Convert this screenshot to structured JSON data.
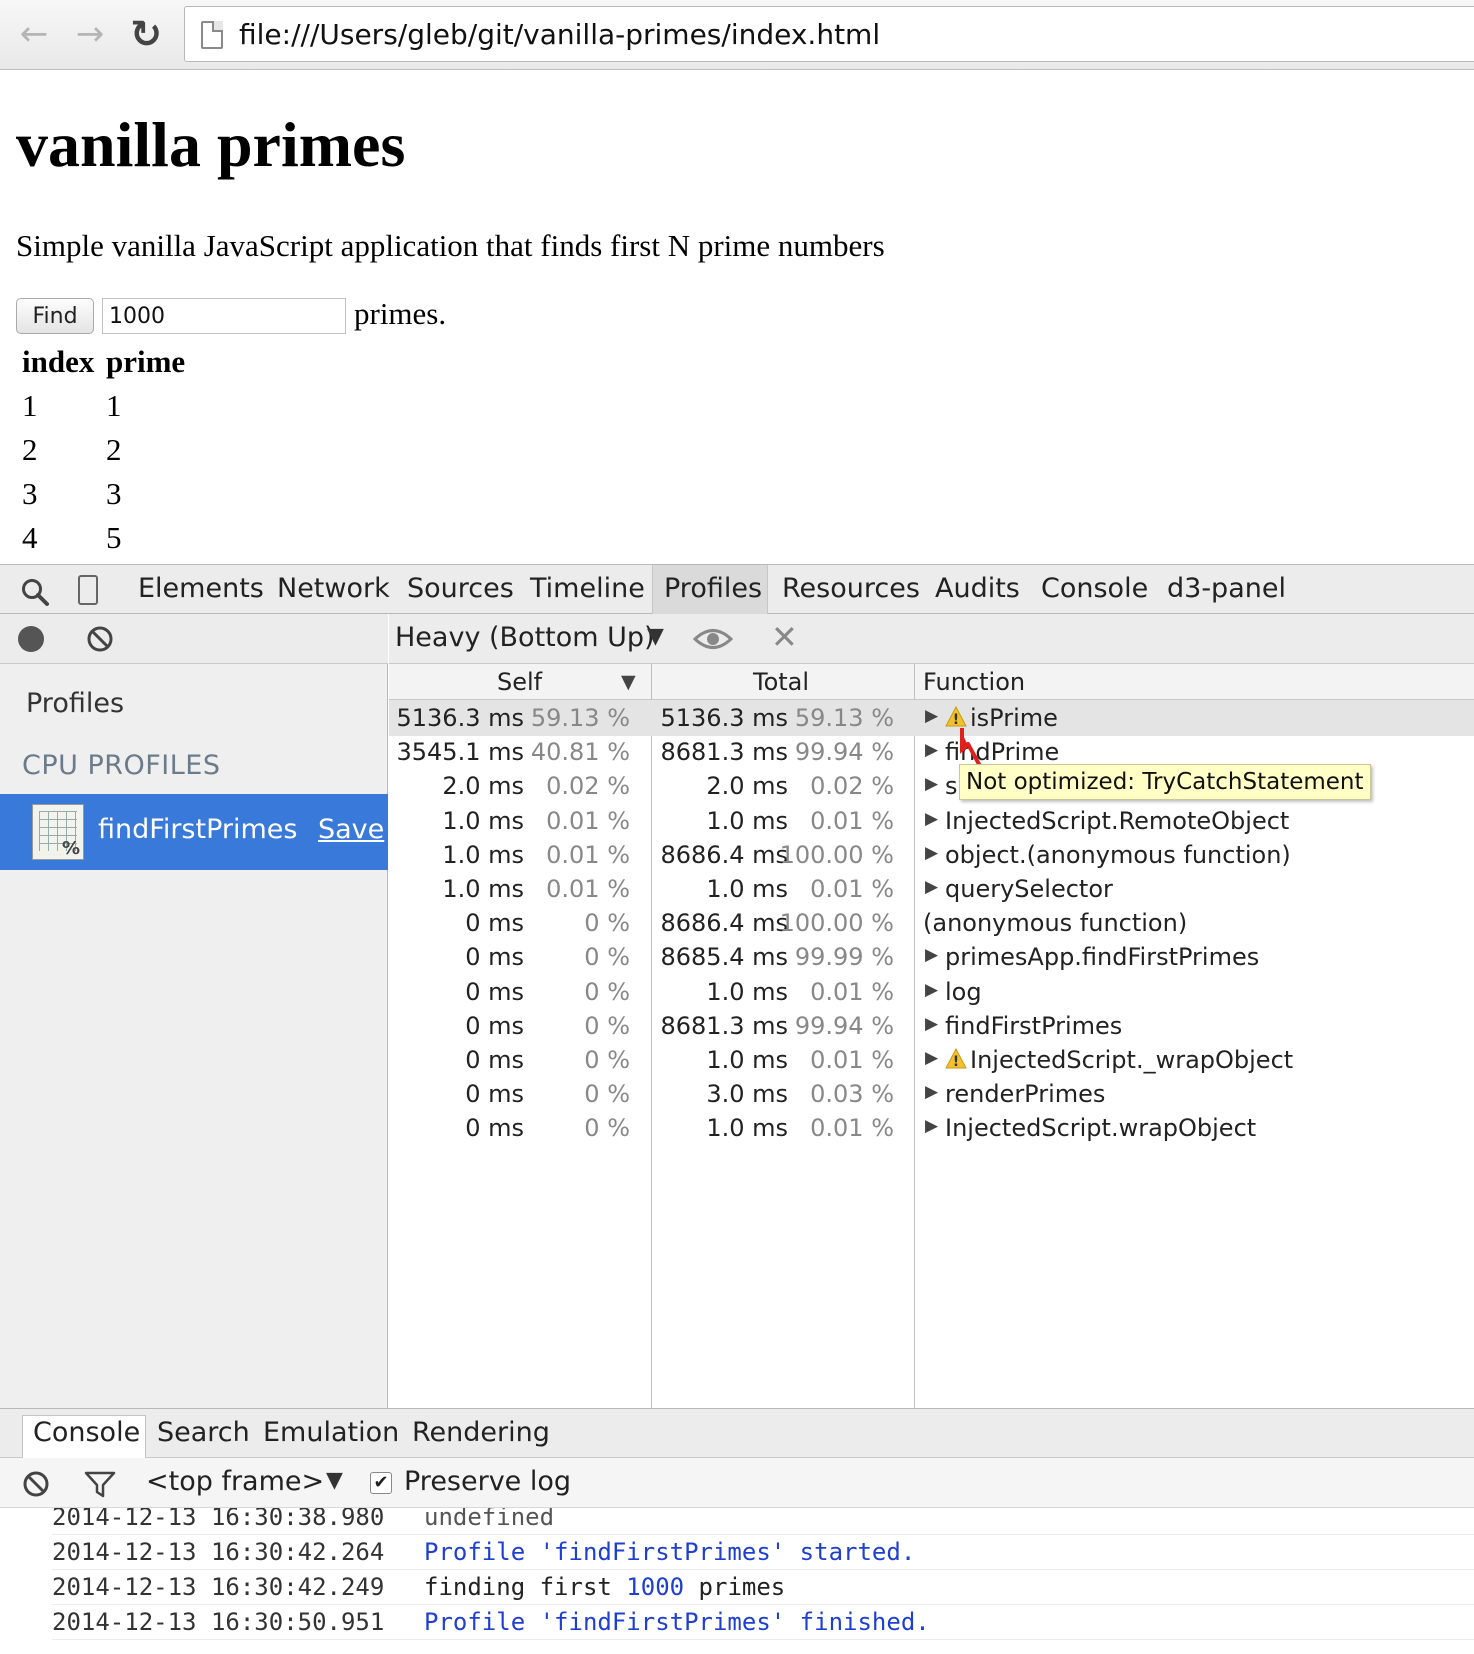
{
  "browser": {
    "url": "file:///Users/gleb/git/vanilla-primes/index.html"
  },
  "page": {
    "title": "vanilla primes",
    "description": "Simple vanilla JavaScript application that finds first N prime numbers",
    "find_label": "Find",
    "count_value": "1000",
    "primes_suffix": "primes.",
    "table": {
      "headers": [
        "index",
        "prime"
      ],
      "rows": [
        [
          "1",
          "1"
        ],
        [
          "2",
          "2"
        ],
        [
          "3",
          "3"
        ],
        [
          "4",
          "5"
        ]
      ]
    }
  },
  "devtools": {
    "tabs": [
      "Elements",
      "Network",
      "Sources",
      "Timeline",
      "Profiles",
      "Resources",
      "Audits",
      "Console",
      "d3-panel"
    ],
    "active_tab": "Profiles",
    "sidebar": {
      "profiles_heading": "Profiles",
      "cpu_profiles_heading": "CPU PROFILES",
      "profile_name": "findFirstPrimes",
      "save_label": "Save"
    },
    "profiler": {
      "view_mode": "Heavy (Bottom Up)",
      "columns": {
        "self": "Self",
        "total": "Total",
        "function": "Function"
      },
      "rows": [
        {
          "self_ms": "5136.3 ms",
          "self_pct": "59.13 %",
          "total_ms": "5136.3 ms",
          "total_pct": "59.13 %",
          "fn": "isPrime",
          "expandable": true,
          "warning": true
        },
        {
          "self_ms": "3545.1 ms",
          "self_pct": "40.81 %",
          "total_ms": "8681.3 ms",
          "total_pct": "99.94 %",
          "fn": "findPrime",
          "expandable": true,
          "warning": false
        },
        {
          "self_ms": "2.0 ms",
          "self_pct": "0.02 %",
          "total_ms": "2.0 ms",
          "total_pct": "0.02 %",
          "fn": "s",
          "expandable": true,
          "warning": false
        },
        {
          "self_ms": "1.0 ms",
          "self_pct": "0.01 %",
          "total_ms": "1.0 ms",
          "total_pct": "0.01 %",
          "fn": "InjectedScript.RemoteObject",
          "expandable": true,
          "warning": false
        },
        {
          "self_ms": "1.0 ms",
          "self_pct": "0.01 %",
          "total_ms": "8686.4 ms",
          "total_pct": "100.00 %",
          "fn": "object.(anonymous function)",
          "expandable": true,
          "warning": false
        },
        {
          "self_ms": "1.0 ms",
          "self_pct": "0.01 %",
          "total_ms": "1.0 ms",
          "total_pct": "0.01 %",
          "fn": "querySelector",
          "expandable": true,
          "warning": false
        },
        {
          "self_ms": "0 ms",
          "self_pct": "0 %",
          "total_ms": "8686.4 ms",
          "total_pct": "100.00 %",
          "fn": "(anonymous function)",
          "expandable": false,
          "warning": false
        },
        {
          "self_ms": "0 ms",
          "self_pct": "0 %",
          "total_ms": "8685.4 ms",
          "total_pct": "99.99 %",
          "fn": "primesApp.findFirstPrimes",
          "expandable": true,
          "warning": false
        },
        {
          "self_ms": "0 ms",
          "self_pct": "0 %",
          "total_ms": "1.0 ms",
          "total_pct": "0.01 %",
          "fn": "log",
          "expandable": true,
          "warning": false
        },
        {
          "self_ms": "0 ms",
          "self_pct": "0 %",
          "total_ms": "8681.3 ms",
          "total_pct": "99.94 %",
          "fn": "findFirstPrimes",
          "expandable": true,
          "warning": false
        },
        {
          "self_ms": "0 ms",
          "self_pct": "0 %",
          "total_ms": "1.0 ms",
          "total_pct": "0.01 %",
          "fn": "InjectedScript._wrapObject",
          "expandable": true,
          "warning": true
        },
        {
          "self_ms": "0 ms",
          "self_pct": "0 %",
          "total_ms": "3.0 ms",
          "total_pct": "0.03 %",
          "fn": "renderPrimes",
          "expandable": true,
          "warning": false
        },
        {
          "self_ms": "0 ms",
          "self_pct": "0 %",
          "total_ms": "1.0 ms",
          "total_pct": "0.01 %",
          "fn": "InjectedScript.wrapObject",
          "expandable": true,
          "warning": false
        }
      ],
      "tooltip": "Not optimized: TryCatchStatement"
    },
    "drawer": {
      "tabs": [
        "Console",
        "Search",
        "Emulation",
        "Rendering"
      ],
      "frame": "<top frame>",
      "preserve_log_label": "Preserve log",
      "preserve_log_checked": true,
      "log": [
        {
          "time": "2014-12-13 16:30:38.980",
          "msg": "undefined",
          "style": "gray"
        },
        {
          "time": "2014-12-13 16:30:42.264",
          "msg": "Profile 'findFirstPrimes' started.",
          "style": "blue"
        },
        {
          "time": "2014-12-13 16:30:42.249",
          "msg_before": "finding first ",
          "msg_num": "1000",
          "msg_after": " primes",
          "style": "mixed"
        },
        {
          "time": "2014-12-13 16:30:50.951",
          "msg": "Profile 'findFirstPrimes' finished.",
          "style": "blue"
        }
      ]
    }
  }
}
